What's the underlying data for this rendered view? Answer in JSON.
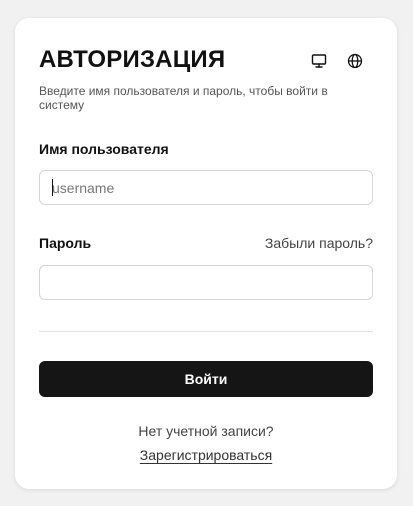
{
  "header": {
    "title": "АВТОРИЗАЦИЯ",
    "subtitle": "Введите имя пользователя и пароль, чтобы войти в систему",
    "icons": [
      "monitor-icon",
      "globe-icon"
    ]
  },
  "form": {
    "username_label": "Имя пользователя",
    "username_placeholder": "username",
    "username_value": "",
    "password_label": "Пароль",
    "password_value": "",
    "forgot_label": "Забыли пароль?",
    "submit_label": "Войти"
  },
  "footer": {
    "no_account_text": "Нет учетной записи?",
    "register_label": "Зарегистрироваться"
  },
  "colors": {
    "background": "#f1f1f1",
    "card": "#ffffff",
    "primary_button": "#151515",
    "input_border": "#d6d6d6"
  }
}
